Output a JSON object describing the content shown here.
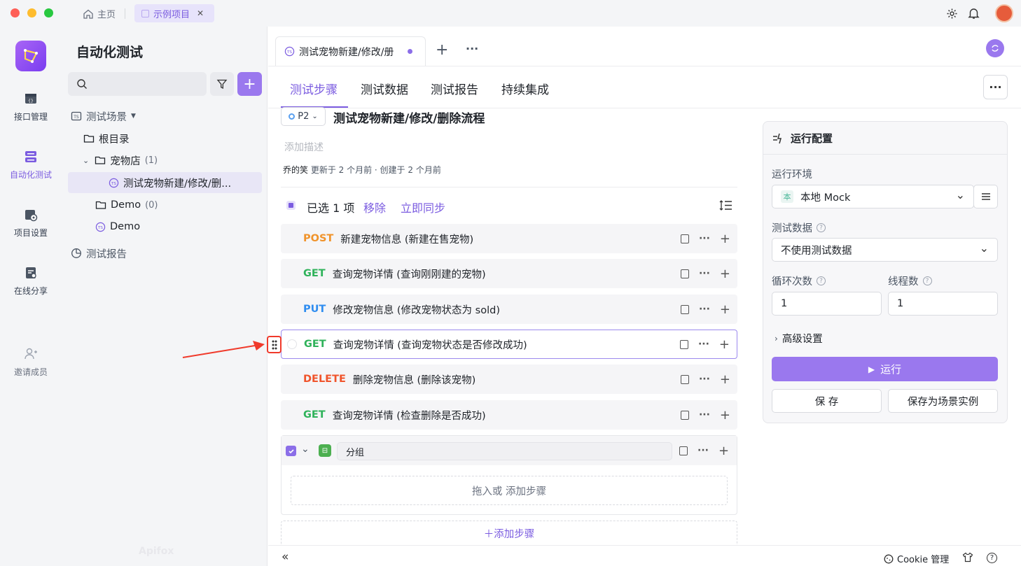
{
  "titlebar": {
    "home_label": "主页",
    "project_tab": "示例项目",
    "close": "✕"
  },
  "rail": {
    "items": [
      {
        "label": "接口管理"
      },
      {
        "label": "自动化测试"
      },
      {
        "label": "项目设置"
      },
      {
        "label": "在线分享"
      },
      {
        "label": "邀请成员"
      }
    ],
    "watermark": "Apifox"
  },
  "tree": {
    "title": "自动化测试",
    "add": "+",
    "scenes_label": "测试场景",
    "root_label": "根目录",
    "petshop_label": "宠物店",
    "petshop_count": "(1)",
    "selected_item": "测试宠物新建/修改/删...",
    "demo_folder": "Demo",
    "demo_count": "(0)",
    "demo_item": "Demo",
    "reports_label": "测试报告"
  },
  "doc_tab": {
    "label": "测试宠物新建/修改/册",
    "add": "+",
    "more": "···"
  },
  "subtabs": [
    "测试步骤",
    "测试数据",
    "测试报告",
    "持续集成"
  ],
  "more_btn": "···",
  "scenario": {
    "priority": "P2",
    "title": "测试宠物新建/修改/删除流程",
    "desc_placeholder": "添加描述",
    "author": "乔的笑",
    "meta": "更新于 2 个月前 · 创建于 2 个月前"
  },
  "selection": {
    "count_text": "已选 1 项",
    "remove": "移除",
    "sync": "立即同步"
  },
  "steps": [
    {
      "method": "POST",
      "color": "#f0932b",
      "name": "新建宠物信息 (新建在售宠物)"
    },
    {
      "method": "GET",
      "color": "#2fb25a",
      "name": "查询宠物详情 (查询刚刚建的宠物)"
    },
    {
      "method": "PUT",
      "color": "#2f8df0",
      "name": "修改宠物信息 (修改宠物状态为 sold)"
    },
    {
      "method": "GET",
      "color": "#2fb25a",
      "name": "查询宠物详情 (查询宠物状态是否修改成功)"
    },
    {
      "method": "DELETE",
      "color": "#f0542b",
      "name": "删除宠物信息 (删除该宠物)"
    },
    {
      "method": "GET",
      "color": "#2fb25a",
      "name": "查询宠物详情 (检查删除是否成功)"
    }
  ],
  "group": {
    "name": "分组",
    "drop_text": "拖入或 添加步骤"
  },
  "add_step": "＋添加步骤",
  "run_config": {
    "title": "运行配置",
    "env_label": "运行环境",
    "env_badge": "本",
    "env_value": "本地 Mock",
    "data_label": "测试数据",
    "data_value": "不使用测试数据",
    "loop_label": "循环次数",
    "loop_value": "1",
    "thread_label": "线程数",
    "thread_value": "1",
    "advanced": "高级设置",
    "run": "运行",
    "save": "保 存",
    "save_as": "保存为场景实例",
    "help": "?"
  },
  "bottom": {
    "collapse": "«",
    "cookie": "Cookie 管理",
    "help": "?"
  },
  "colors": {
    "accent": "#7b5ce0",
    "run_button": "#9a78ee"
  }
}
